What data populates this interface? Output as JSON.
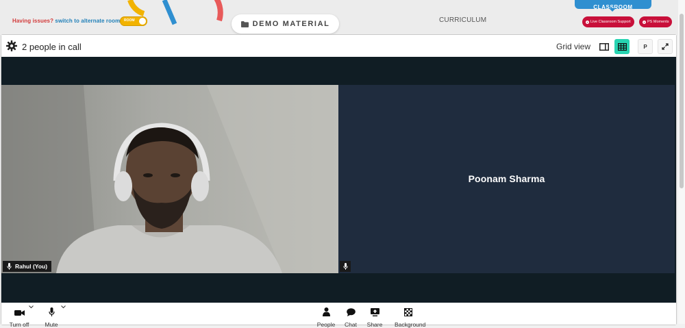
{
  "topbar": {
    "issues_warn": "Having issues?",
    "issues_link": "switch to alternate room",
    "room_toggle_label": "ROOM",
    "demo_material_label": "DEMO MATERIAL",
    "curriculum_label": "CURRICULUM",
    "classroom_label": "CLASSROOM",
    "live_support_label": "Live Classroom Support",
    "ps_moments_label": "PS Moments"
  },
  "call": {
    "people_count": "2 people in call",
    "grid_view_label": "Grid view",
    "pin_label": "P"
  },
  "participants": [
    {
      "name": "Rahul (You)"
    },
    {
      "name": "Poonam Sharma"
    }
  ],
  "toolbar": {
    "camera_label": "Turn off",
    "mute_label": "Mute",
    "people_label": "People",
    "chat_label": "Chat",
    "share_label": "Share",
    "background_label": "Background"
  },
  "colors": {
    "accent_teal": "#27d3b1",
    "alert_red": "#c8103a",
    "classroom_blue": "#2f8fd0",
    "toggle_yellow": "#f2b300",
    "stage_dark": "#101d24",
    "remote_tile": "#1f2c3e"
  }
}
